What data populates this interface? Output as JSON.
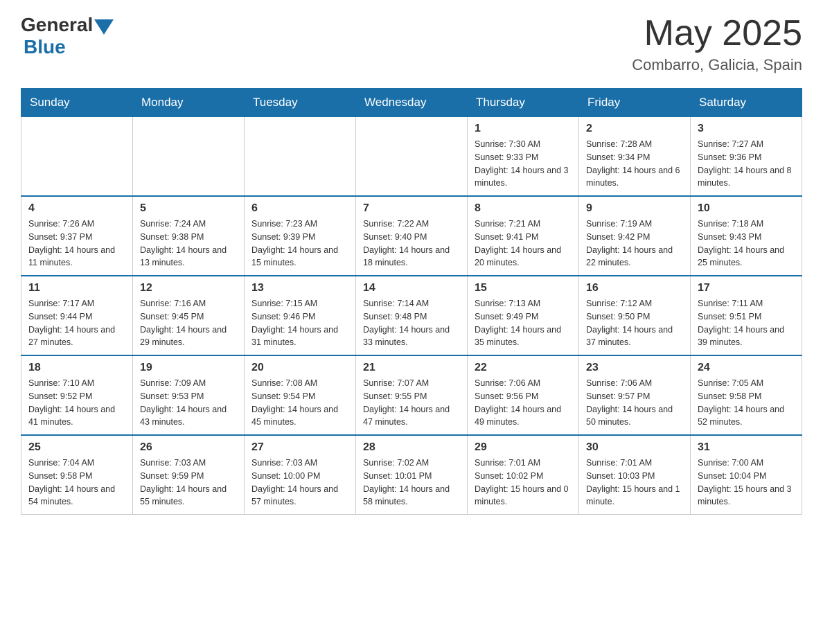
{
  "header": {
    "logo_general": "General",
    "logo_blue": "Blue",
    "month_title": "May 2025",
    "location": "Combarro, Galicia, Spain"
  },
  "weekdays": [
    "Sunday",
    "Monday",
    "Tuesday",
    "Wednesday",
    "Thursday",
    "Friday",
    "Saturday"
  ],
  "weeks": [
    [
      {
        "day": "",
        "info": ""
      },
      {
        "day": "",
        "info": ""
      },
      {
        "day": "",
        "info": ""
      },
      {
        "day": "",
        "info": ""
      },
      {
        "day": "1",
        "info": "Sunrise: 7:30 AM\nSunset: 9:33 PM\nDaylight: 14 hours\nand 3 minutes."
      },
      {
        "day": "2",
        "info": "Sunrise: 7:28 AM\nSunset: 9:34 PM\nDaylight: 14 hours\nand 6 minutes."
      },
      {
        "day": "3",
        "info": "Sunrise: 7:27 AM\nSunset: 9:36 PM\nDaylight: 14 hours\nand 8 minutes."
      }
    ],
    [
      {
        "day": "4",
        "info": "Sunrise: 7:26 AM\nSunset: 9:37 PM\nDaylight: 14 hours\nand 11 minutes."
      },
      {
        "day": "5",
        "info": "Sunrise: 7:24 AM\nSunset: 9:38 PM\nDaylight: 14 hours\nand 13 minutes."
      },
      {
        "day": "6",
        "info": "Sunrise: 7:23 AM\nSunset: 9:39 PM\nDaylight: 14 hours\nand 15 minutes."
      },
      {
        "day": "7",
        "info": "Sunrise: 7:22 AM\nSunset: 9:40 PM\nDaylight: 14 hours\nand 18 minutes."
      },
      {
        "day": "8",
        "info": "Sunrise: 7:21 AM\nSunset: 9:41 PM\nDaylight: 14 hours\nand 20 minutes."
      },
      {
        "day": "9",
        "info": "Sunrise: 7:19 AM\nSunset: 9:42 PM\nDaylight: 14 hours\nand 22 minutes."
      },
      {
        "day": "10",
        "info": "Sunrise: 7:18 AM\nSunset: 9:43 PM\nDaylight: 14 hours\nand 25 minutes."
      }
    ],
    [
      {
        "day": "11",
        "info": "Sunrise: 7:17 AM\nSunset: 9:44 PM\nDaylight: 14 hours\nand 27 minutes."
      },
      {
        "day": "12",
        "info": "Sunrise: 7:16 AM\nSunset: 9:45 PM\nDaylight: 14 hours\nand 29 minutes."
      },
      {
        "day": "13",
        "info": "Sunrise: 7:15 AM\nSunset: 9:46 PM\nDaylight: 14 hours\nand 31 minutes."
      },
      {
        "day": "14",
        "info": "Sunrise: 7:14 AM\nSunset: 9:48 PM\nDaylight: 14 hours\nand 33 minutes."
      },
      {
        "day": "15",
        "info": "Sunrise: 7:13 AM\nSunset: 9:49 PM\nDaylight: 14 hours\nand 35 minutes."
      },
      {
        "day": "16",
        "info": "Sunrise: 7:12 AM\nSunset: 9:50 PM\nDaylight: 14 hours\nand 37 minutes."
      },
      {
        "day": "17",
        "info": "Sunrise: 7:11 AM\nSunset: 9:51 PM\nDaylight: 14 hours\nand 39 minutes."
      }
    ],
    [
      {
        "day": "18",
        "info": "Sunrise: 7:10 AM\nSunset: 9:52 PM\nDaylight: 14 hours\nand 41 minutes."
      },
      {
        "day": "19",
        "info": "Sunrise: 7:09 AM\nSunset: 9:53 PM\nDaylight: 14 hours\nand 43 minutes."
      },
      {
        "day": "20",
        "info": "Sunrise: 7:08 AM\nSunset: 9:54 PM\nDaylight: 14 hours\nand 45 minutes."
      },
      {
        "day": "21",
        "info": "Sunrise: 7:07 AM\nSunset: 9:55 PM\nDaylight: 14 hours\nand 47 minutes."
      },
      {
        "day": "22",
        "info": "Sunrise: 7:06 AM\nSunset: 9:56 PM\nDaylight: 14 hours\nand 49 minutes."
      },
      {
        "day": "23",
        "info": "Sunrise: 7:06 AM\nSunset: 9:57 PM\nDaylight: 14 hours\nand 50 minutes."
      },
      {
        "day": "24",
        "info": "Sunrise: 7:05 AM\nSunset: 9:58 PM\nDaylight: 14 hours\nand 52 minutes."
      }
    ],
    [
      {
        "day": "25",
        "info": "Sunrise: 7:04 AM\nSunset: 9:58 PM\nDaylight: 14 hours\nand 54 minutes."
      },
      {
        "day": "26",
        "info": "Sunrise: 7:03 AM\nSunset: 9:59 PM\nDaylight: 14 hours\nand 55 minutes."
      },
      {
        "day": "27",
        "info": "Sunrise: 7:03 AM\nSunset: 10:00 PM\nDaylight: 14 hours\nand 57 minutes."
      },
      {
        "day": "28",
        "info": "Sunrise: 7:02 AM\nSunset: 10:01 PM\nDaylight: 14 hours\nand 58 minutes."
      },
      {
        "day": "29",
        "info": "Sunrise: 7:01 AM\nSunset: 10:02 PM\nDaylight: 15 hours\nand 0 minutes."
      },
      {
        "day": "30",
        "info": "Sunrise: 7:01 AM\nSunset: 10:03 PM\nDaylight: 15 hours\nand 1 minute."
      },
      {
        "day": "31",
        "info": "Sunrise: 7:00 AM\nSunset: 10:04 PM\nDaylight: 15 hours\nand 3 minutes."
      }
    ]
  ]
}
